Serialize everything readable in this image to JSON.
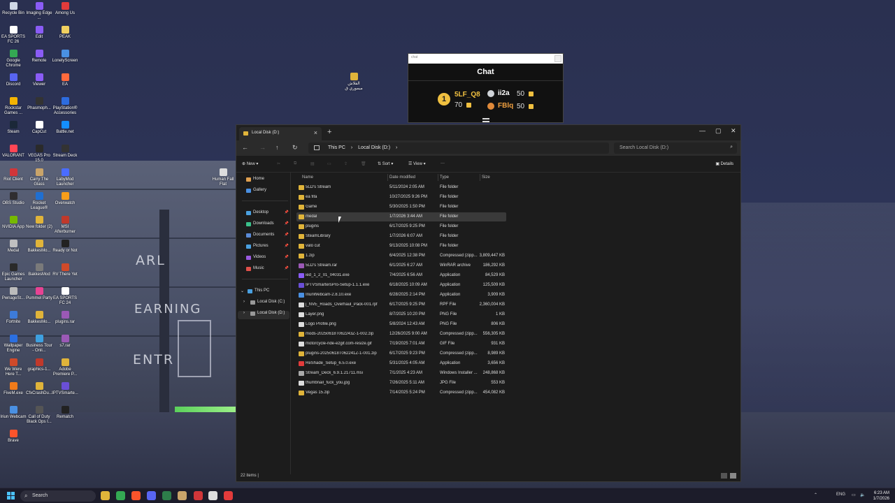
{
  "desktop": {
    "icons": [
      {
        "label": "Recycle Bin",
        "color": "#cfd8e6"
      },
      {
        "label": "Imaging Edge ...",
        "color": "#8a5cf5"
      },
      {
        "label": "Among Us",
        "color": "#e23b3b"
      },
      {
        "label": "EA SPORTS FC 26",
        "color": "#ffffff"
      },
      {
        "label": "Edit",
        "color": "#8a5cf5"
      },
      {
        "label": "PEAK",
        "color": "#f0d060"
      },
      {
        "label": "Google Chrome",
        "color": "#34a853"
      },
      {
        "label": "Remote",
        "color": "#8a5cf5"
      },
      {
        "label": "LonelyScreen",
        "color": "#4a90e2"
      },
      {
        "label": "Discord",
        "color": "#5865f2"
      },
      {
        "label": "Viewer",
        "color": "#8a5cf5"
      },
      {
        "label": "EA",
        "color": "#ff6a3d"
      },
      {
        "label": "Rockstar Games ...",
        "color": "#f4b400"
      },
      {
        "label": "Phasmoph...",
        "color": "#333333"
      },
      {
        "label": "PlayStation® Accessories",
        "color": "#2d6cdf"
      },
      {
        "label": "Steam",
        "color": "#1b2838"
      },
      {
        "label": "CapCut",
        "color": "#ffffff"
      },
      {
        "label": "Battle.net",
        "color": "#148eff"
      },
      {
        "label": "VALORANT",
        "color": "#ff4655"
      },
      {
        "label": "VEGAS Pro 15.0",
        "color": "#2a2a2a"
      },
      {
        "label": "Stream Deck",
        "color": "#333333"
      },
      {
        "label": "Riot Client",
        "color": "#d13639"
      },
      {
        "label": "Carry The Glass",
        "color": "#c9a46a"
      },
      {
        "label": "LabyMod Launcher",
        "color": "#4a6cff"
      },
      {
        "label": "OBS Studio",
        "color": "#302e31"
      },
      {
        "label": "Rocket League®",
        "color": "#1f6fd1"
      },
      {
        "label": "Overwatch",
        "color": "#f99e1a"
      },
      {
        "label": "NVIDIA App",
        "color": "#76b900"
      },
      {
        "label": "New folder (2)",
        "color": "#e0b43a"
      },
      {
        "label": "MSI Afterburner",
        "color": "#c0392b"
      },
      {
        "label": "Medal",
        "color": "#c0c0c0"
      },
      {
        "label": "BakkesMo...",
        "color": "#e0b43a"
      },
      {
        "label": "Ready or Not",
        "color": "#222222"
      },
      {
        "label": "Epic Games Launcher",
        "color": "#2a2a2a"
      },
      {
        "label": "BakkesMod",
        "color": "#7a7a7a"
      },
      {
        "label": "RV There Yet",
        "color": "#d14a2a"
      },
      {
        "label": "PwnageSt...",
        "color": "#bbbbbb"
      },
      {
        "label": "Pummel Party",
        "color": "#e84393"
      },
      {
        "label": "EA SPORTS FC 24",
        "color": "#ffffff"
      },
      {
        "label": "Fortnite",
        "color": "#3d7bd9"
      },
      {
        "label": "BakkesMo...",
        "color": "#e0b43a"
      },
      {
        "label": "plugins.rar",
        "color": "#9b59b6"
      },
      {
        "label": "Wallpaper Engine",
        "color": "#2b6fe0"
      },
      {
        "label": "Business Tour - Onli...",
        "color": "#3da0e0"
      },
      {
        "label": "s7.rar",
        "color": "#9b59b6"
      },
      {
        "label": "We Were Here T...",
        "color": "#d04a2a"
      },
      {
        "label": "graphics-1...",
        "color": "#c0392b"
      },
      {
        "label": "Adobe Premiere P...",
        "color": "#e0b43a"
      },
      {
        "label": "FiveM.exe",
        "color": "#f07b1a"
      },
      {
        "label": "CfxCrashDu...",
        "color": "#e0b43a"
      },
      {
        "label": "IPTVSmarte...",
        "color": "#6a4fd6"
      },
      {
        "label": "Iriun Webcam",
        "color": "#4a90e2"
      },
      {
        "label": "Call of Duty Black Ops I...",
        "color": "#555555"
      },
      {
        "label": "Rematch",
        "color": "#222222"
      },
      {
        "label": "Brave",
        "color": "#fb542b"
      }
    ],
    "loose_icons": [
      {
        "label": "الفلاش ميموري ق",
        "color": "#e0b43a"
      },
      {
        "label": "Human Fall Flat",
        "color": "#dddddd"
      }
    ],
    "wallpaper_text": [
      "ARL",
      "EARNING",
      "ENTR"
    ]
  },
  "chat": {
    "window_title": "chat",
    "heading": "Chat",
    "leaders": [
      {
        "rank": "1",
        "name": "5LF_Q8",
        "score": "70",
        "name_color": "#f0c040"
      },
      {
        "rank": "",
        "name": "ii2a",
        "score": "50",
        "name_color": "#ffffff"
      },
      {
        "rank": "",
        "name": "FBlq",
        "score": "50",
        "name_color": "#f0a040"
      }
    ]
  },
  "explorer": {
    "tab_title": "Local Disk (D:)",
    "address": [
      "This PC",
      "Local Disk (D:)"
    ],
    "search_placeholder": "Search Local Disk (D:)",
    "toolbar": {
      "new": "New",
      "sort": "Sort",
      "view": "View",
      "more": "···",
      "details": "Details"
    },
    "sidebar": {
      "top": [
        {
          "label": "Home",
          "color": "#e0a050"
        },
        {
          "label": "Gallery",
          "color": "#4a90e2"
        }
      ],
      "quick": [
        {
          "label": "Desktop",
          "color": "#4aa0e0"
        },
        {
          "label": "Downloads",
          "color": "#3ac08a"
        },
        {
          "label": "Documents",
          "color": "#5a8ad6"
        },
        {
          "label": "Pictures",
          "color": "#4aa0e0"
        },
        {
          "label": "Videos",
          "color": "#9a5ae0"
        },
        {
          "label": "Music",
          "color": "#e0504a"
        }
      ],
      "tree": [
        {
          "label": "This PC",
          "color": "#4aa0e0"
        },
        {
          "label": "Local Disk (C:)",
          "color": "#999999"
        },
        {
          "label": "Local Disk (D:)",
          "color": "#999999"
        }
      ]
    },
    "columns": {
      "name": "Name",
      "date": "Date modified",
      "type": "Type",
      "size": "Size"
    },
    "files": [
      {
        "name": "5LD's Stream",
        "date": "5/11/2024 2:05 AM",
        "type": "File folder",
        "size": "",
        "color": "#e0b43a"
      },
      {
        "name": "ea fifa",
        "date": "10/27/2025 9:26 PM",
        "type": "File folder",
        "size": "",
        "color": "#e0b43a"
      },
      {
        "name": "Game",
        "date": "5/30/2025 1:50 PM",
        "type": "File folder",
        "size": "",
        "color": "#e0b43a"
      },
      {
        "name": "medal",
        "date": "1/7/2026 3:44 AM",
        "type": "File folder",
        "size": "",
        "color": "#e0b43a"
      },
      {
        "name": "plugins",
        "date": "6/17/2025 9:25 PM",
        "type": "File folder",
        "size": "",
        "color": "#e0b43a"
      },
      {
        "name": "SteamLibrary",
        "date": "1/7/2026 6:07 AM",
        "type": "File folder",
        "size": "",
        "color": "#e0b43a"
      },
      {
        "name": "valo cut",
        "date": "9/13/2025 10:08 PM",
        "type": "File folder",
        "size": "",
        "color": "#e0b43a"
      },
      {
        "name": "1.zip",
        "date": "6/4/2025 12:38 PM",
        "type": "Compressed (zipp...",
        "size": "3,809,447 KB",
        "color": "#e0b43a"
      },
      {
        "name": "5LD's Stream.rar",
        "date": "6/1/2025 6:27 AM",
        "type": "WinRAR archive",
        "size": "186,292 KB",
        "color": "#9b59b6"
      },
      {
        "name": "ied_1_2_01_04031.exe",
        "date": "7/4/2025 6:56 AM",
        "type": "Application",
        "size": "84,529 KB",
        "color": "#8a5cf5"
      },
      {
        "name": "IPTVSmartersPro-Setup-1.1.1.exe",
        "date": "6/18/2025 10:09 AM",
        "type": "Application",
        "size": "125,509 KB",
        "color": "#6a4fd6"
      },
      {
        "name": "IriunWebcam-2.8.10.exe",
        "date": "6/28/2025 2:14 PM",
        "type": "Application",
        "size": "3,909 KB",
        "color": "#4a90e2"
      },
      {
        "name": "j_NVE_Roads_Overhaul_Pack-001.rpf",
        "date": "6/17/2025 9:25 PM",
        "type": "RPF File",
        "size": "2,360,004 KB",
        "color": "#dddddd"
      },
      {
        "name": "Layer.png",
        "date": "8/7/2025 10:20 PM",
        "type": "PNG File",
        "size": "1 KB",
        "color": "#dddddd"
      },
      {
        "name": "Logo Profile.png",
        "date": "5/8/2024 12:43 AM",
        "type": "PNG File",
        "size": "806 KB",
        "color": "#dddddd"
      },
      {
        "name": "mods-20250618T062243Z-1-002.zip",
        "date": "12/26/2025 9:00 AM",
        "type": "Compressed (zipp...",
        "size": "556,305 KB",
        "color": "#e0b43a"
      },
      {
        "name": "motorcycle-ride-ezgif.com-resize.gif",
        "date": "7/19/2025 7:01 AM",
        "type": "GIF File",
        "size": "931 KB",
        "color": "#dddddd"
      },
      {
        "name": "plugins-20250618T062241Z-1-001.zip",
        "date": "6/17/2025 9:23 PM",
        "type": "Compressed (zipp...",
        "size": "8,989 KB",
        "color": "#e0b43a"
      },
      {
        "name": "ReShade_Setup_6.5.0.exe",
        "date": "5/31/2025 4:05 AM",
        "type": "Application",
        "size": "3,656 KB",
        "color": "#e23b3b"
      },
      {
        "name": "Stream_Deck_6.9.1.21711.msi",
        "date": "7/1/2025 4:23 AM",
        "type": "Windows Installer ...",
        "size": "248,868 KB",
        "color": "#aaaaaa"
      },
      {
        "name": "thumbnail_fuck_you.jpg",
        "date": "7/26/2025 5:11 AM",
        "type": "JPG File",
        "size": "553 KB",
        "color": "#dddddd"
      },
      {
        "name": "Vegas 15.zip",
        "date": "7/14/2025 5:24 PM",
        "type": "Compressed (zipp...",
        "size": "454,082 KB",
        "color": "#e0b43a"
      }
    ],
    "status": "22 items  |"
  },
  "taskbar": {
    "search": "Search",
    "apps": [
      "#e0b43a",
      "#34a853",
      "#fb542b",
      "#5865f2",
      "#2d7d4a",
      "#c9a46a",
      "#d13639",
      "#dddddd",
      "#e23b3b"
    ],
    "lang": "ENG",
    "time": "6:23 AM",
    "date": "1/7/2026"
  }
}
